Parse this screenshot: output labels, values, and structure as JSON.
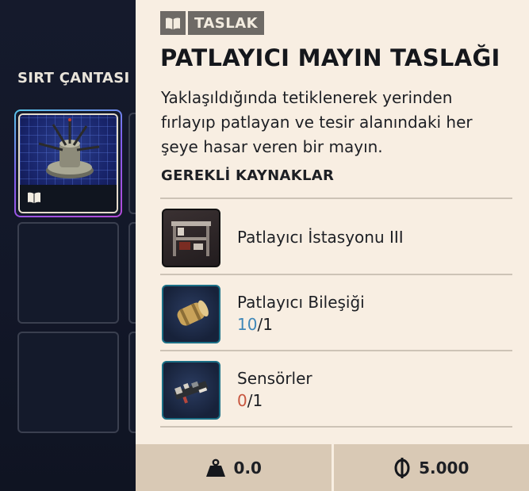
{
  "backpack": {
    "title": "SIRT ÇANTASI"
  },
  "tooltip": {
    "badge_label": "TASLAK",
    "title": "PATLAYICI MAYIN TASLAĞI",
    "description": "Yaklaşıldığında tetiklenerek yerinden fırlayıp patlayan ve tesir alanındaki her şeye hasar veren bir mayın.",
    "resources_title": "GEREKLİ KAYNAKLAR",
    "resources": [
      {
        "name": "Patlayıcı İstasyonu III",
        "icon": "workbench-icon"
      },
      {
        "name": "Patlayıcı Bileşiği",
        "have": "10",
        "sep": "/",
        "need": "1",
        "icon": "explosive-compound-icon"
      },
      {
        "name": "Sensörler",
        "have": "0",
        "sep": "/",
        "need": "1",
        "icon": "sensors-icon"
      }
    ],
    "footer": {
      "weight": "0.0",
      "price": "5.000"
    }
  },
  "colors": {
    "panel_bg": "#f8eee2",
    "footer_bg": "#d9c9b5",
    "qty_available": "#3f87b8",
    "qty_missing": "#c8563f",
    "badge_bg": "#6e6a66"
  }
}
